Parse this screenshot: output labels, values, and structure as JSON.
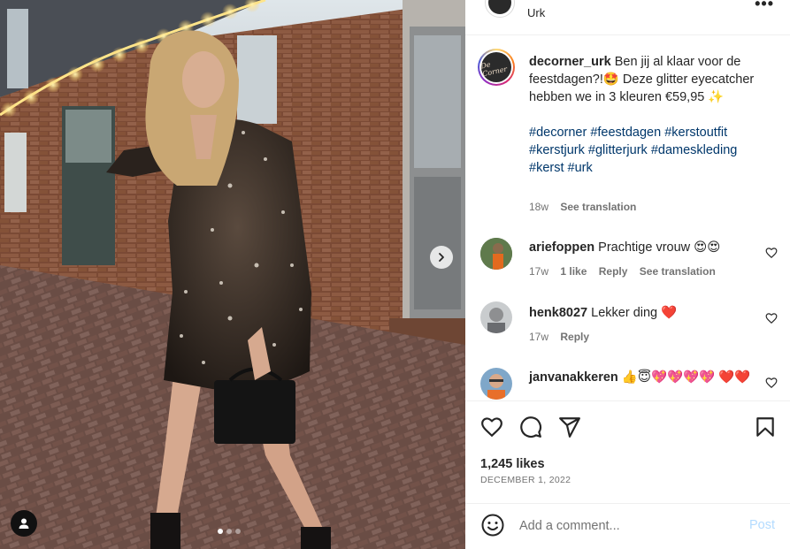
{
  "header": {
    "location": "Urk",
    "more_label": "•••"
  },
  "media": {
    "carousel_count": 3,
    "active_index": 0
  },
  "caption": {
    "username": "decorner_urk",
    "text": " Ben jij al klaar voor de feestdagen?!🤩 Deze glitter eyecatcher hebben we in 3 kleuren €59,95 ✨",
    "hashtags": [
      "#decorner",
      "#feestdagen",
      "#kerstoutfit",
      "#kerstjurk",
      "#glitterjurk",
      "#dameskleding",
      "#kerst",
      "#urk"
    ],
    "age": "18w",
    "translation_label": "See translation"
  },
  "comments": [
    {
      "username": "ariefoppen",
      "text": " Prachtige vrouw 😍😍",
      "age": "17w",
      "likes": "1 like",
      "reply_label": "Reply",
      "translation_label": "See translation"
    },
    {
      "username": "henk8027",
      "text": " Lekker ding ❤️",
      "age": "17w",
      "reply_label": "Reply"
    },
    {
      "username": "janvanakkeren",
      "text": " 👍😇💖💖💖💖 ❤️❤️"
    }
  ],
  "actions": {
    "likes": "1,245 likes",
    "date": "DECEMBER 1, 2022"
  },
  "comment_box": {
    "placeholder": "Add a comment...",
    "post_label": "Post"
  },
  "colors": {
    "text": "#262626",
    "muted": "#737373",
    "hashtag": "#00376b",
    "post_disabled": "#b3dbff",
    "heart_red": "#ed4956"
  },
  "icons": [
    "heart-icon",
    "comment-icon",
    "share-icon",
    "bookmark-icon",
    "emoji-icon",
    "chevron-right-icon",
    "user-tag-icon",
    "more-icon"
  ]
}
